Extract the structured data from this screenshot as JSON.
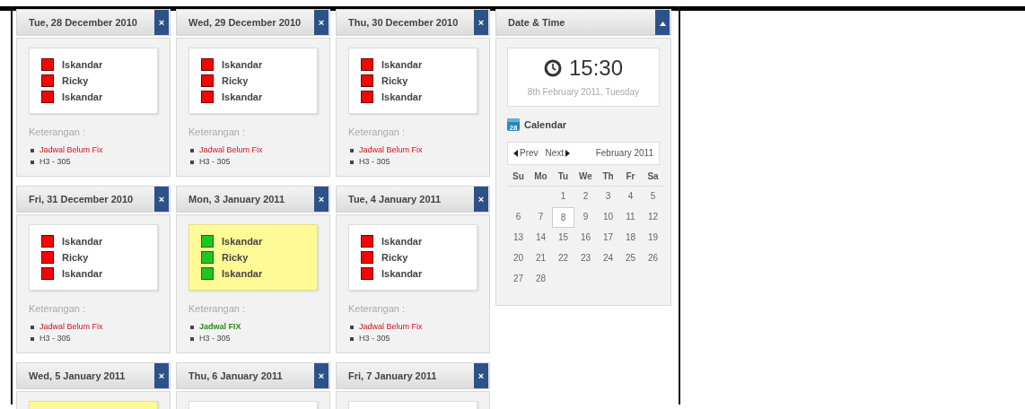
{
  "days": [
    {
      "date": "Tue, 28 December 2010",
      "close": "×",
      "fixed": false,
      "persons": [
        "Iskandar",
        "Ricky",
        "Iskandar"
      ],
      "notes_label": "Keterangan :",
      "notes": [
        {
          "kind": "status",
          "text": "Jadwal Belum Fix"
        },
        {
          "kind": "room",
          "text": "H3 - 305"
        }
      ]
    },
    {
      "date": "Wed, 29 December 2010",
      "close": "×",
      "fixed": false,
      "persons": [
        "Iskandar",
        "Ricky",
        "Iskandar"
      ],
      "notes_label": "Keterangan :",
      "notes": [
        {
          "kind": "status",
          "text": "Jadwal Belum Fix"
        },
        {
          "kind": "room",
          "text": "H3 - 305"
        }
      ]
    },
    {
      "date": "Thu, 30 December 2010",
      "close": "×",
      "fixed": false,
      "persons": [
        "Iskandar",
        "Ricky",
        "Iskandar"
      ],
      "notes_label": "Keterangan :",
      "notes": [
        {
          "kind": "status",
          "text": "Jadwal Belum Fix"
        },
        {
          "kind": "room",
          "text": "H3 - 305"
        }
      ]
    },
    {
      "date": "Fri, 31 December 2010",
      "close": "×",
      "fixed": false,
      "persons": [
        "Iskandar",
        "Ricky",
        "Iskandar"
      ],
      "notes_label": "Keterangan :",
      "notes": [
        {
          "kind": "status",
          "text": "Jadwal Belum Fix"
        },
        {
          "kind": "room",
          "text": "H3 - 305"
        }
      ]
    },
    {
      "date": "Mon, 3 January 2011",
      "close": "×",
      "fixed": true,
      "persons": [
        "Iskandar",
        "Ricky",
        "Iskandar"
      ],
      "notes_label": "Keterangan :",
      "notes": [
        {
          "kind": "status",
          "text": "Jadwal FIX"
        },
        {
          "kind": "room",
          "text": "H3 - 305"
        }
      ]
    },
    {
      "date": "Tue, 4 January 2011",
      "close": "×",
      "fixed": false,
      "persons": [
        "Iskandar",
        "Ricky",
        "Iskandar"
      ],
      "notes_label": "Keterangan :",
      "notes": [
        {
          "kind": "status",
          "text": "Jadwal Belum Fix"
        },
        {
          "kind": "room",
          "text": "H3 - 305"
        }
      ]
    },
    {
      "date": "Wed, 5 January 2011",
      "close": "×",
      "fixed": true
    },
    {
      "date": "Thu, 6 January 2011",
      "close": "×",
      "fixed": false
    },
    {
      "date": "Fri, 7 January 2011",
      "close": "×",
      "fixed": false
    }
  ],
  "datetime": {
    "title": "Date & Time",
    "time": "15:30",
    "date": "8th February 2011, Tuesday",
    "calendar_title": "Calendar",
    "calendar_icon_day": "28",
    "prev": "Prev",
    "next": "Next",
    "month": "February 2011",
    "weekdays": [
      "Su",
      "Mo",
      "Tu",
      "We",
      "Th",
      "Fr",
      "Sa"
    ],
    "weeks": [
      [
        {
          "day": "1",
          "selected": false
        },
        {
          "day": "2",
          "selected": false
        },
        {
          "day": "3",
          "selected": false
        },
        {
          "day": "4",
          "selected": false
        },
        {
          "day": "5",
          "selected": false
        }
      ],
      [
        {
          "day": "6",
          "selected": false
        },
        {
          "day": "7",
          "selected": false
        },
        {
          "day": "8",
          "selected": true
        },
        {
          "day": "9",
          "selected": false
        },
        {
          "day": "10",
          "selected": false
        },
        {
          "day": "11",
          "selected": false
        },
        {
          "day": "12",
          "selected": false
        }
      ],
      [
        {
          "day": "13",
          "selected": false
        },
        {
          "day": "14",
          "selected": false
        },
        {
          "day": "15",
          "selected": false
        },
        {
          "day": "16",
          "selected": false
        },
        {
          "day": "17",
          "selected": false
        },
        {
          "day": "18",
          "selected": false
        },
        {
          "day": "19",
          "selected": false
        }
      ],
      [
        {
          "day": "20",
          "selected": false
        },
        {
          "day": "21",
          "selected": false
        },
        {
          "day": "22",
          "selected": false
        },
        {
          "day": "23",
          "selected": false
        },
        {
          "day": "24",
          "selected": false
        },
        {
          "day": "25",
          "selected": false
        },
        {
          "day": "26",
          "selected": false
        }
      ],
      [
        {
          "day": "27",
          "selected": false
        },
        {
          "day": "28",
          "selected": false
        }
      ]
    ]
  }
}
